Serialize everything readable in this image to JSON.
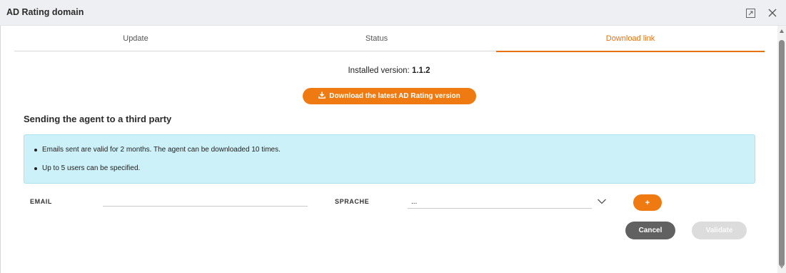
{
  "window": {
    "title": "AD Rating domain",
    "maximize_icon": "maximize-icon",
    "close_icon": "close-icon"
  },
  "tabs": [
    {
      "label": "Update",
      "active": false
    },
    {
      "label": "Status",
      "active": false
    },
    {
      "label": "Download link",
      "active": true
    }
  ],
  "installed": {
    "label": "Installed version:",
    "version": "1.1.2"
  },
  "download_button": {
    "label": "Download the latest AD Rating version",
    "icon": "download-icon"
  },
  "section": {
    "title": "Sending the agent to a third party"
  },
  "info_box": {
    "lines": [
      "Emails sent are valid for 2 months. The agent can be downloaded 10 times.",
      "Up to 5 users can be specified."
    ]
  },
  "form": {
    "email_label": "EMAIL",
    "email_value": "",
    "language_label": "SPRACHE",
    "language_value": "...",
    "add_label": "+"
  },
  "actions": {
    "cancel": "Cancel",
    "validate": "Validate"
  },
  "colors": {
    "accent": "#f07a12",
    "info_bg": "#cdf1f8",
    "cancel_bg": "#616161",
    "disabled_bg": "#dcdcdc"
  }
}
